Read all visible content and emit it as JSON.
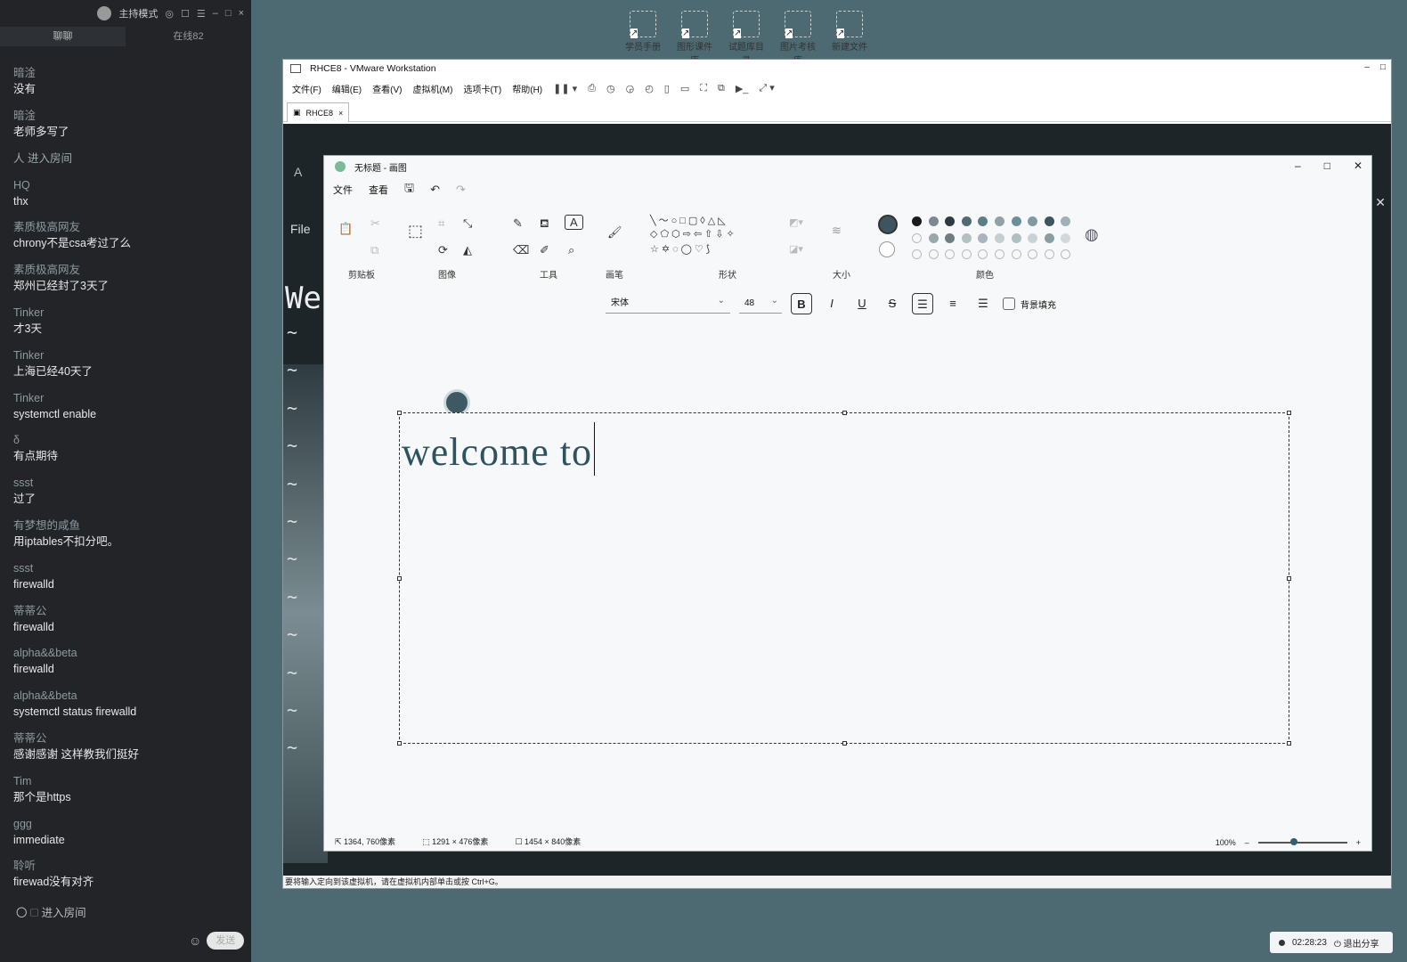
{
  "chat": {
    "header": {
      "mode": "主持模式"
    },
    "tabs": [
      "聊聊",
      "在线82"
    ],
    "messages": [
      {
        "nick": "暗淦",
        "text": "没有"
      },
      {
        "nick": "暗淦",
        "text": "老师多写了"
      },
      {
        "system": "人 进入房间"
      },
      {
        "nick": "HQ",
        "text": "thx"
      },
      {
        "nick": "素质极高网友",
        "text": "chrony不是csa考过了么"
      },
      {
        "nick": "素质极高网友",
        "text": "郑州已经封了3天了"
      },
      {
        "nick": "Tinker",
        "text": "才3天"
      },
      {
        "nick": "Tinker",
        "text": "上海已经40天了"
      },
      {
        "nick": "Tinker",
        "text": "systemctl enable"
      },
      {
        "nick": "δ",
        "text": "有点期待"
      },
      {
        "nick": "ssst",
        "text": "过了"
      },
      {
        "nick": "有梦想的咸鱼",
        "text": "用iptables不扣分吧。"
      },
      {
        "nick": "ssst",
        "text": "firewalld"
      },
      {
        "nick": "蒂蒂公",
        "text": "firewalld"
      },
      {
        "nick": "alpha&&beta",
        "text": "firewalld"
      },
      {
        "nick": "alpha&&beta",
        "text": "systemctl status firewalld"
      },
      {
        "nick": "蒂蒂公",
        "text": "感谢感谢  这样教我们挺好"
      },
      {
        "nick": "Tim",
        "text": "那个是https"
      },
      {
        "nick": "ggg",
        "text": "immediate"
      },
      {
        "nick": "聆听",
        "text": "firewad没有对齐"
      }
    ],
    "bottom_system": "〇 🗆 进入房间",
    "send_label": "发送"
  },
  "desktop_shortcuts": [
    "学员手册",
    "图形课件库",
    "试题库目录",
    "图片考核库",
    "新建文件"
  ],
  "vmware": {
    "title": "RHCE8 - VMware Workstation",
    "menu": [
      "文件(F)",
      "编辑(E)",
      "查看(V)",
      "虚拟机(M)",
      "选项卡(T)",
      "帮助(H)"
    ],
    "tab": "RHCE8",
    "guest": {
      "file_menu": "File",
      "heading_fragment": "We",
      "activities_fragment": "A",
      "tilde": "~"
    },
    "status": "要将输入定向到该虚拟机，请在虚拟机内部单击或按 Ctrl+G。"
  },
  "paint": {
    "title": "无标题 - 画图",
    "menu": [
      "文件",
      "查看"
    ],
    "groups": [
      "剪贴板",
      "图像",
      "工具",
      "画笔",
      "形状",
      "大小",
      "颜色"
    ],
    "font_name": "宋体",
    "font_size": "48",
    "bg_fill_label": "背景填充",
    "canvas_text": "welcome to",
    "status": {
      "cursor": "1364, 760像素",
      "selection": "1291 × 476像素",
      "canvas": "1454 × 840像素",
      "zoom": "100%"
    },
    "zoom_fraction": 0.4,
    "colors": {
      "row1": [
        "#1a1a1a",
        "#7a8a90",
        "#2d3a40",
        "#4f6a74",
        "#5e7d88",
        "#8ea2a8",
        "#6f8f98",
        "#7f9aa2",
        "#3d5560",
        "#9fb2b7"
      ],
      "row2": [
        "empty",
        "#9aa8ac",
        "#6f7d82",
        "#b3c0c4",
        "#a7b6bb",
        "#c3cfd2",
        "#b0bfc3",
        "#c9d3d6",
        "#8c9da2",
        "#d1d9dc"
      ],
      "row3": [
        "empty",
        "empty",
        "empty",
        "empty",
        "empty",
        "empty",
        "empty",
        "empty",
        "empty",
        "empty"
      ],
      "primary": "#3d5560"
    }
  },
  "share": {
    "time": "02:28:23",
    "exit_label": "退出分享"
  }
}
